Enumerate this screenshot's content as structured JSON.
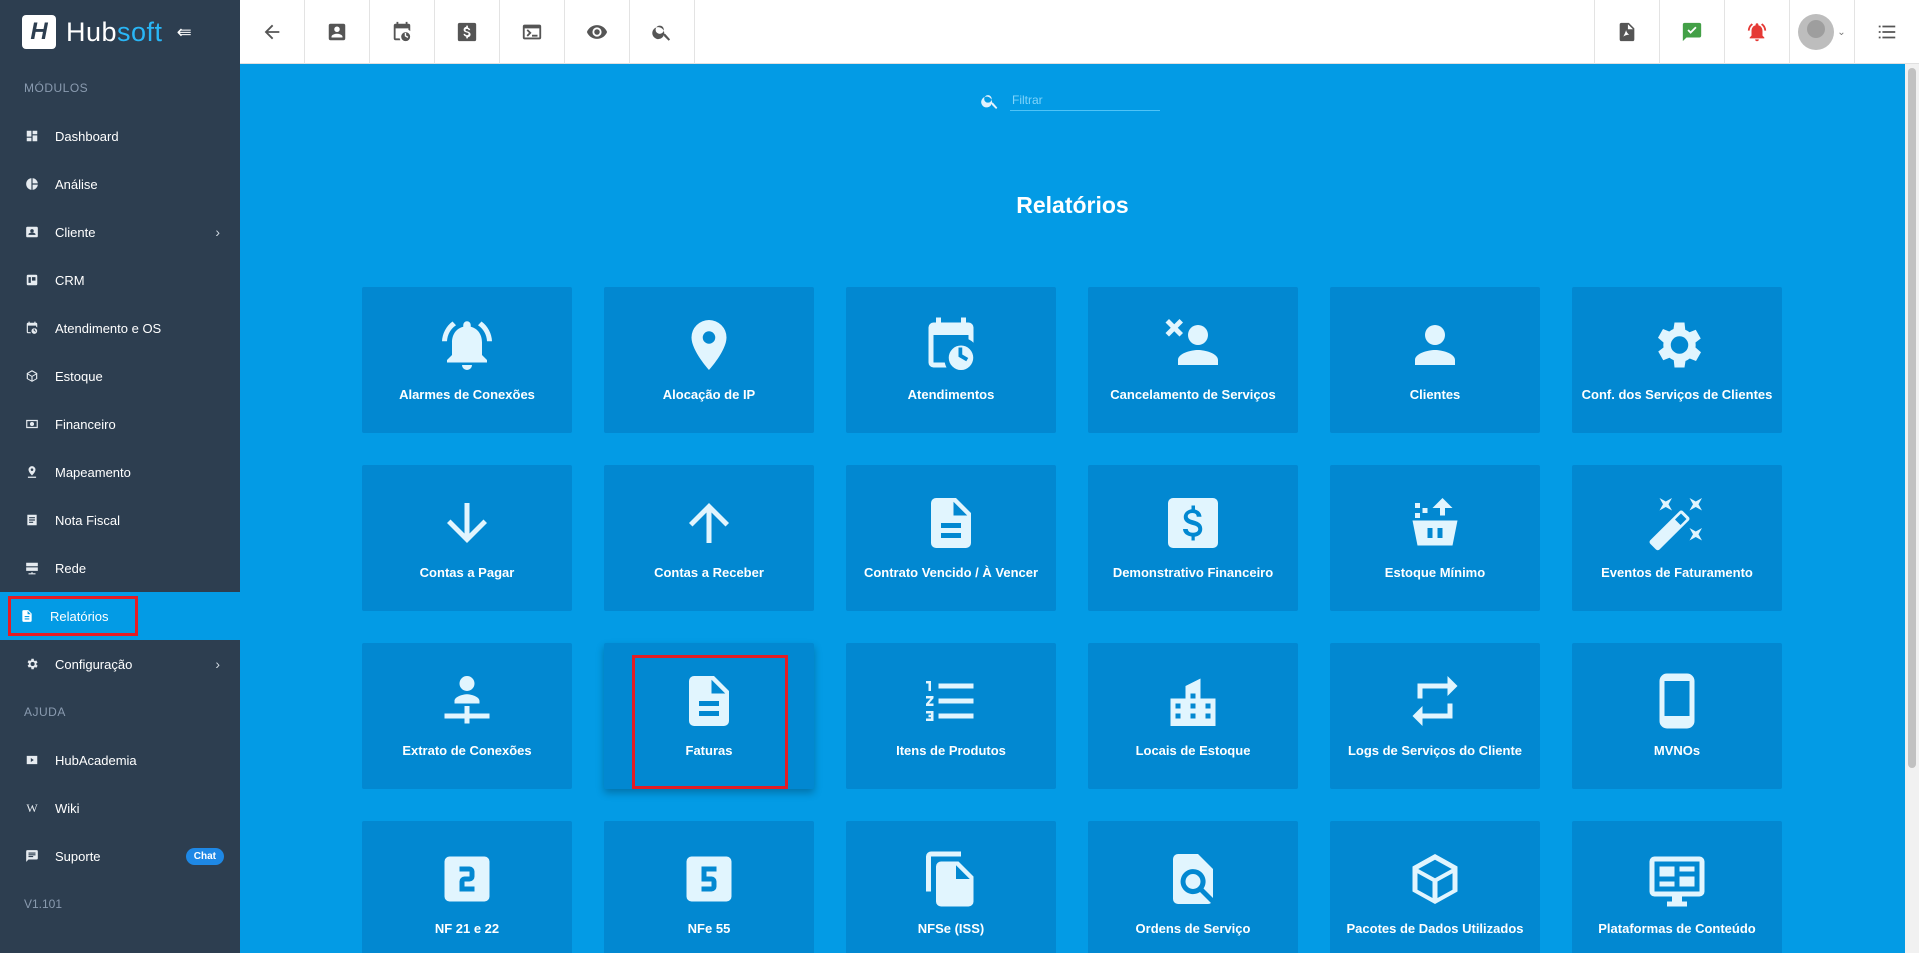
{
  "brand": {
    "prefix": "Hub",
    "suffix": "soft"
  },
  "sidebar": {
    "modules_label": "MÓDULOS",
    "items": [
      {
        "label": "Dashboard",
        "icon": "dashboard-icon"
      },
      {
        "label": "Análise",
        "icon": "pie-chart-icon"
      },
      {
        "label": "Cliente",
        "icon": "contact-card-icon"
      },
      {
        "label": "CRM",
        "icon": "board-icon"
      },
      {
        "label": "Atendimento e OS",
        "icon": "calendar-clock-icon"
      },
      {
        "label": "Estoque",
        "icon": "box-icon"
      },
      {
        "label": "Financeiro",
        "icon": "money-icon"
      },
      {
        "label": "Mapeamento",
        "icon": "map-pin-icon"
      },
      {
        "label": "Nota Fiscal",
        "icon": "receipt-icon"
      },
      {
        "label": "Rede",
        "icon": "server-icon"
      },
      {
        "label": "Relatórios",
        "icon": "document-icon"
      },
      {
        "label": "Configuração",
        "icon": "gear-icon"
      }
    ],
    "help_label": "AJUDA",
    "help_items": [
      {
        "label": "HubAcademia",
        "icon": "play-icon"
      },
      {
        "label": "Wiki",
        "icon": "wiki-icon"
      },
      {
        "label": "Suporte",
        "icon": "chat-icon",
        "badge": "Chat"
      }
    ],
    "version": "V1.101"
  },
  "main": {
    "filter_placeholder": "Filtrar",
    "title": "Relatórios",
    "tiles": [
      "Alarmes de Conexões",
      "Alocação de IP",
      "Atendimentos",
      "Cancelamento de Serviços",
      "Clientes",
      "Conf. dos Serviços de Clientes",
      "Contas a Pagar",
      "Contas a Receber",
      "Contrato Vencido / À Vencer",
      "Demonstrativo Financeiro",
      "Estoque Mínimo",
      "Eventos de Faturamento",
      "Extrato de Conexões",
      "Faturas",
      "Itens de Produtos",
      "Locais de Estoque",
      "Logs de Serviços do Cliente",
      "MVNOs",
      "NF 21 e 22",
      "NFe 55",
      "NFSe (ISS)",
      "Ordens de Serviço",
      "Pacotes de Dados Utilizados",
      "Plataformas de Conteúdo"
    ]
  },
  "colors": {
    "sidebar_bg": "#2d3e50",
    "main_bg": "#039be5",
    "tile_bg": "#0288d1",
    "highlight": "#e51c23"
  }
}
